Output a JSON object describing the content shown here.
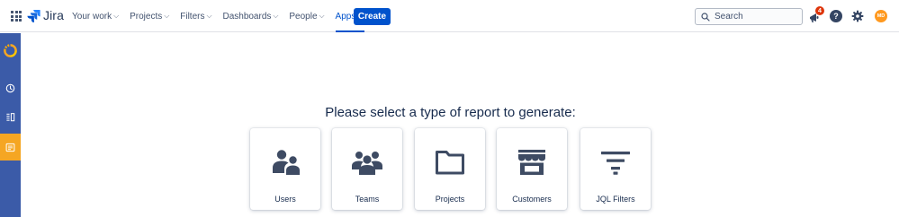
{
  "header": {
    "logo_text": "Jira",
    "nav": [
      {
        "label": "Your work",
        "active": false
      },
      {
        "label": "Projects",
        "active": false
      },
      {
        "label": "Filters",
        "active": false
      },
      {
        "label": "Dashboards",
        "active": false
      },
      {
        "label": "People",
        "active": false
      },
      {
        "label": "Apps",
        "active": true
      }
    ],
    "create_label": "Create",
    "search_placeholder": "Search",
    "notification_count": "4",
    "help_glyph": "?",
    "avatar_initials": "MD"
  },
  "sidebar": {
    "items": [
      {
        "icon": "app-logo-icon"
      },
      {
        "icon": "clock-icon"
      },
      {
        "icon": "board-icon"
      },
      {
        "icon": "report-icon",
        "active": true
      }
    ]
  },
  "main": {
    "heading": "Please select a type of report to generate:",
    "cards": [
      {
        "label": "Users",
        "icon": "users-icon"
      },
      {
        "label": "Teams",
        "icon": "teams-icon"
      },
      {
        "label": "Projects",
        "icon": "folder-icon"
      },
      {
        "label": "Customers",
        "icon": "storefront-icon"
      },
      {
        "label": "JQL Filters",
        "icon": "filter-icon"
      }
    ]
  },
  "colors": {
    "brand_blue": "#0052cc",
    "sidebar_bg": "#3b5ba8",
    "sidebar_active": "#f5a623",
    "icon_dark": "#3e4b63",
    "badge_red": "#de350b",
    "avatar_orange": "#ff991f"
  }
}
